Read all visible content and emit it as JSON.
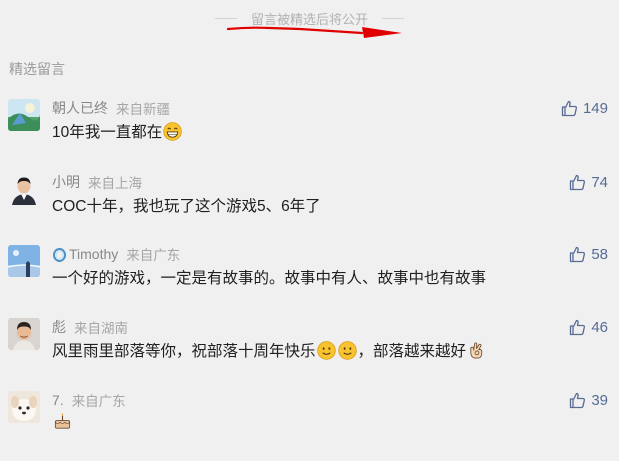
{
  "notice": "留言被精选后将公开",
  "section_title": "精选留言",
  "comments": [
    {
      "name": "朝人已终",
      "location": "来自新疆",
      "text": "10年我一直都在",
      "emoji": [
        "grin-emoji"
      ],
      "likes": "149"
    },
    {
      "name": "小明",
      "location": "来自上海",
      "text": "COC十年，我也玩了这个游戏5、6年了",
      "emoji": [],
      "likes": "74"
    },
    {
      "name": "Timothy",
      "location": "来自广东",
      "text": "一个好的游戏，一定是有故事的。故事中有人、故事中也有故事",
      "emoji": [],
      "likes": "58"
    },
    {
      "name": "彪",
      "location": "来自湖南",
      "text_before": "风里雨里部落等你，祝部落十周年快乐",
      "text_middle": "，部落越来越好",
      "emoji": [
        "smile-emoji",
        "smile-emoji",
        "ok-hand-emoji"
      ],
      "likes": "46"
    },
    {
      "name": "7.",
      "location": "来自广东",
      "text": "",
      "emoji": [
        "cake-emoji"
      ],
      "likes": "39"
    }
  ],
  "colors": {
    "accent": "#576b95",
    "background": "#f0f0f0",
    "annotation": "#e00000"
  }
}
